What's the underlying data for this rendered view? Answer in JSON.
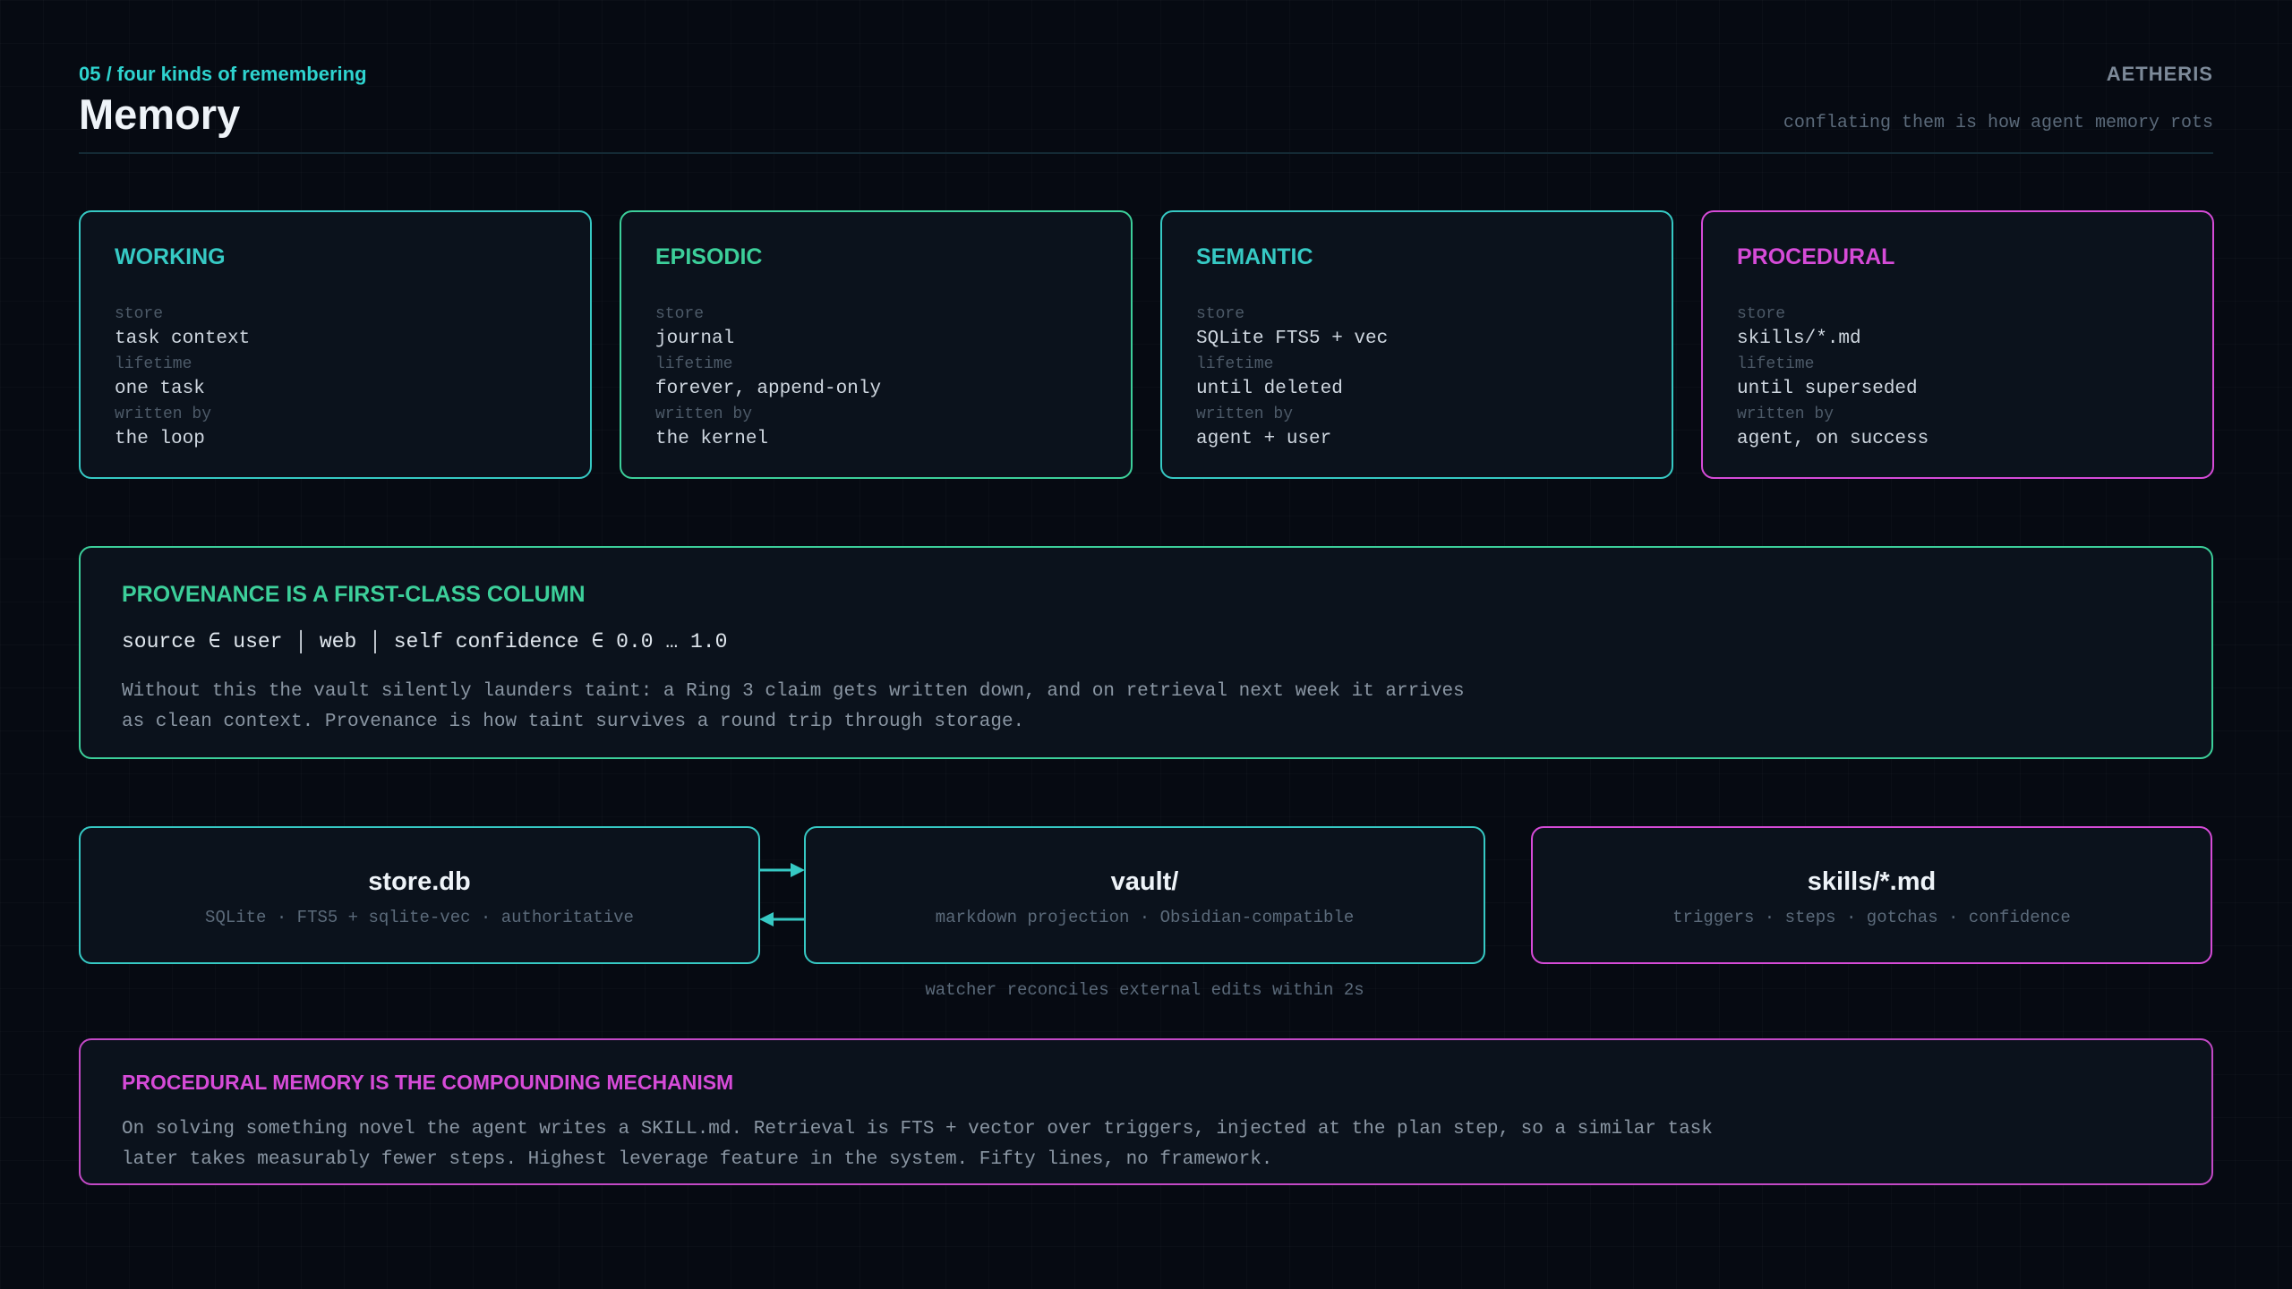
{
  "header": {
    "kicker": "05 / four kinds of remembering",
    "title": "Memory",
    "brand": "AETHERIS",
    "tagline": "conflating them is how agent memory rots"
  },
  "field_labels": {
    "store": "store",
    "lifetime": "lifetime",
    "written_by": "written by"
  },
  "cards": [
    {
      "title": "WORKING",
      "store": "task context",
      "lifetime": "one task",
      "written_by": "the loop"
    },
    {
      "title": "EPISODIC",
      "store": "journal",
      "lifetime": "forever, append-only",
      "written_by": "the kernel"
    },
    {
      "title": "SEMANTIC",
      "store": "SQLite FTS5 + vec",
      "lifetime": "until deleted",
      "written_by": "agent + user"
    },
    {
      "title": "PROCEDURAL",
      "store": "skills/*.md",
      "lifetime": "until superseded",
      "written_by": "agent, on success"
    }
  ],
  "provenance": {
    "title": "PROVENANCE IS A FIRST-CLASS COLUMN",
    "formula": "source ∈ user │ web │ self confidence ∈ 0.0 … 1.0",
    "body": "Without this the vault silently launders taint: a Ring 3 claim gets written down, and on retrieval next week it arrives as clean context. Provenance is how taint survives a round trip through storage."
  },
  "stores": [
    {
      "title": "store.db",
      "subtitle": "SQLite · FTS5 + sqlite-vec · authoritative"
    },
    {
      "title": "vault/",
      "subtitle": "markdown projection · Obsidian-compatible"
    },
    {
      "title": "skills/*.md",
      "subtitle": "triggers · steps · gotchas · confidence"
    }
  ],
  "watcher_note": "watcher reconciles external edits within 2s",
  "procedural_memory": {
    "title": "PROCEDURAL MEMORY IS THE COMPOUNDING MECHANISM",
    "body": "On solving something novel the agent writes a SKILL.md. Retrieval is FTS + vector over triggers, injected at the plan step, so a similar task later takes measurably fewer steps. Highest leverage feature in the system. Fifty lines, no framework."
  },
  "colors": {
    "background": "#060a12",
    "cyan": "#36c9c4",
    "green": "#3ccf9a",
    "magenta": "#d64bd8"
  }
}
